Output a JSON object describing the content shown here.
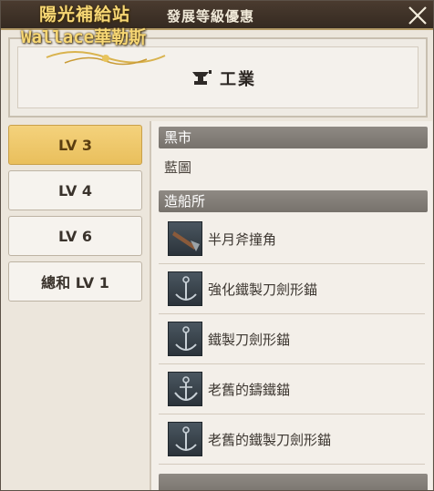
{
  "window": {
    "title": "發展等級優惠",
    "close_label": "×"
  },
  "watermark": {
    "line1": "陽光補給站",
    "line2": "Wallace華勒斯"
  },
  "header": {
    "category_icon": "anvil-icon",
    "category_label": "工業"
  },
  "level_tabs": [
    {
      "label": "LV 3",
      "active": true
    },
    {
      "label": "LV 4",
      "active": false
    },
    {
      "label": "LV 6",
      "active": false
    },
    {
      "label": "總和 LV 1",
      "active": false
    }
  ],
  "content": {
    "section1": {
      "title": "黑市",
      "items": [
        "藍圖"
      ]
    },
    "section2": {
      "title": "造船所",
      "items": [
        {
          "label": "半月斧撞角",
          "icon": "ram-icon"
        },
        {
          "label": "強化鐵製刀劍形錨",
          "icon": "anchor-icon"
        },
        {
          "label": "鐵製刀劍形錨",
          "icon": "anchor-icon"
        },
        {
          "label": "老舊的鑄鐵錨",
          "icon": "anchor-icon"
        },
        {
          "label": "老舊的鐵製刀劍形錨",
          "icon": "anchor-icon"
        }
      ]
    }
  },
  "colors": {
    "active_tab": "#e9bf5c",
    "section_header": "#7f7a74",
    "title_bar": "#3d3026"
  }
}
